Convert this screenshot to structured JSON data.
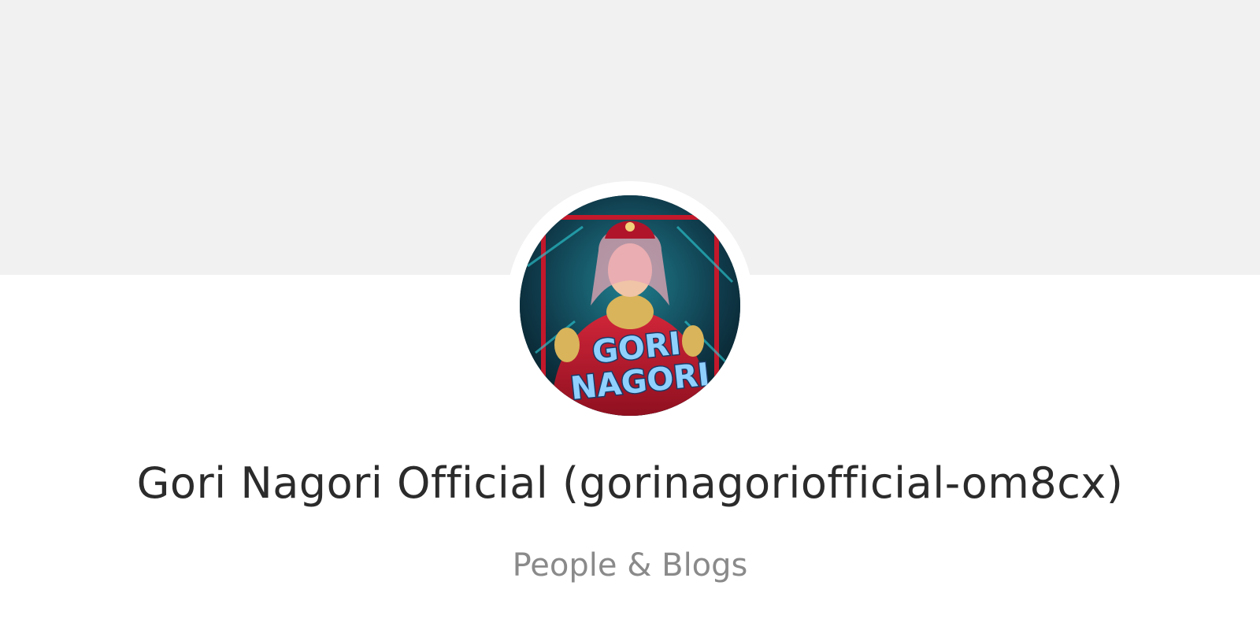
{
  "profile": {
    "avatar_text_line1": "GORI",
    "avatar_text_line2": "NAGORI",
    "title": "Gori Nagori Official (gorinagoriofficial-om8cx)",
    "category": "People & Blogs"
  },
  "colors": {
    "banner": "#f1f1f1",
    "title": "#2b2b2b",
    "category": "#8a8a8a",
    "avatar_bg": "#0f3a4a",
    "avatar_text": "#8fd0ff"
  }
}
